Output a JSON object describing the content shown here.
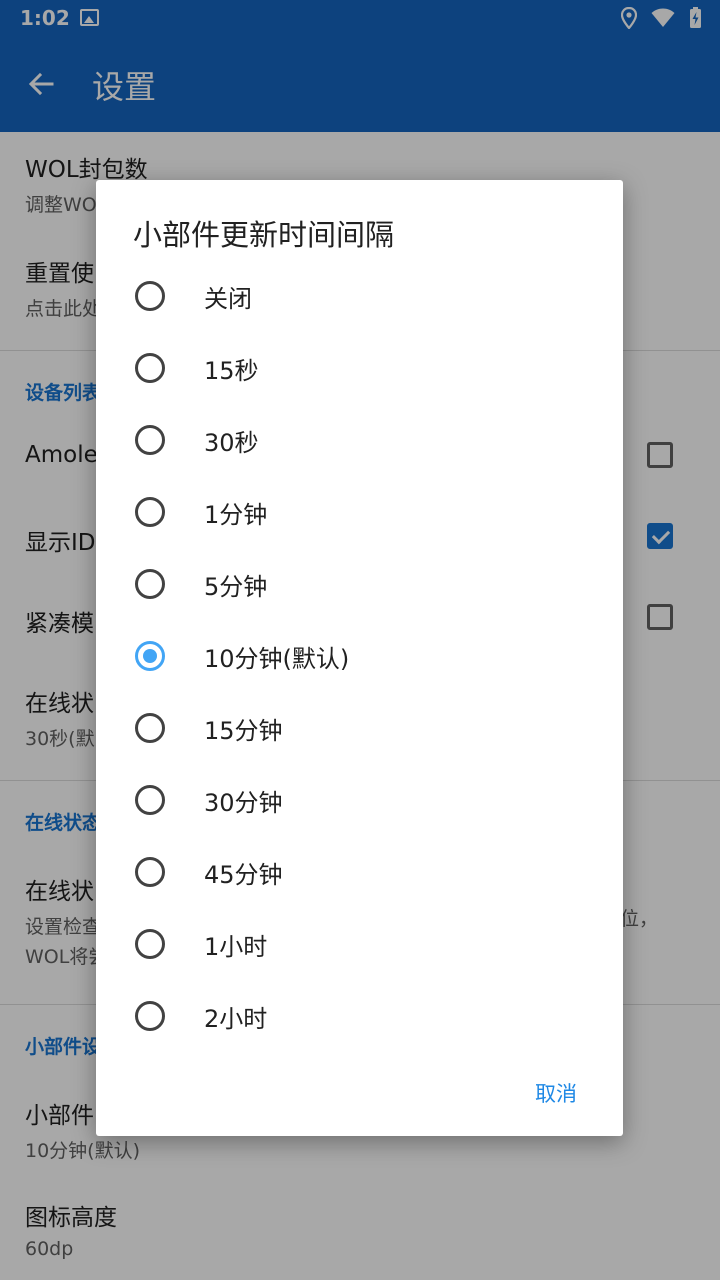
{
  "status_bar": {
    "time": "1:02"
  },
  "app_bar": {
    "title": "设置"
  },
  "settings": {
    "items": [
      {
        "title": "WOL封包数",
        "subtitle": "调整WO"
      },
      {
        "title": "重置使",
        "subtitle": "点击此处"
      }
    ],
    "cat_device_list": "设备列表",
    "amoled": "Amoled",
    "show_id": "显示ID",
    "compact": "紧凑模",
    "online_status_interval": {
      "title": "在线状",
      "subtitle": "30秒(默"
    },
    "cat_online_status": "在线状态",
    "online_check": {
      "title": "在线状",
      "subtitle": "设置检查",
      "subtitle_tail": "位，",
      "subtitle2": "WOL将尝"
    },
    "cat_widget": "小部件设",
    "widget_update": {
      "title": "小部件",
      "subtitle": "10分钟(默认)"
    },
    "icon_height": {
      "title": "图标高度",
      "subtitle": "60dp"
    },
    "checkbox_states": {
      "amoled": false,
      "show_id": true,
      "compact": false
    }
  },
  "dialog": {
    "title": "小部件更新时间间隔",
    "options": [
      "关闭",
      "15秒",
      "30秒",
      "1分钟",
      "5分钟",
      "10分钟(默认)",
      "15分钟",
      "30分钟",
      "45分钟",
      "1小时",
      "2小时"
    ],
    "selected_index": 5,
    "cancel_label": "取消"
  },
  "colors": {
    "primary": "#1565c0",
    "accent": "#42a5f5",
    "category": "#1976d2"
  }
}
